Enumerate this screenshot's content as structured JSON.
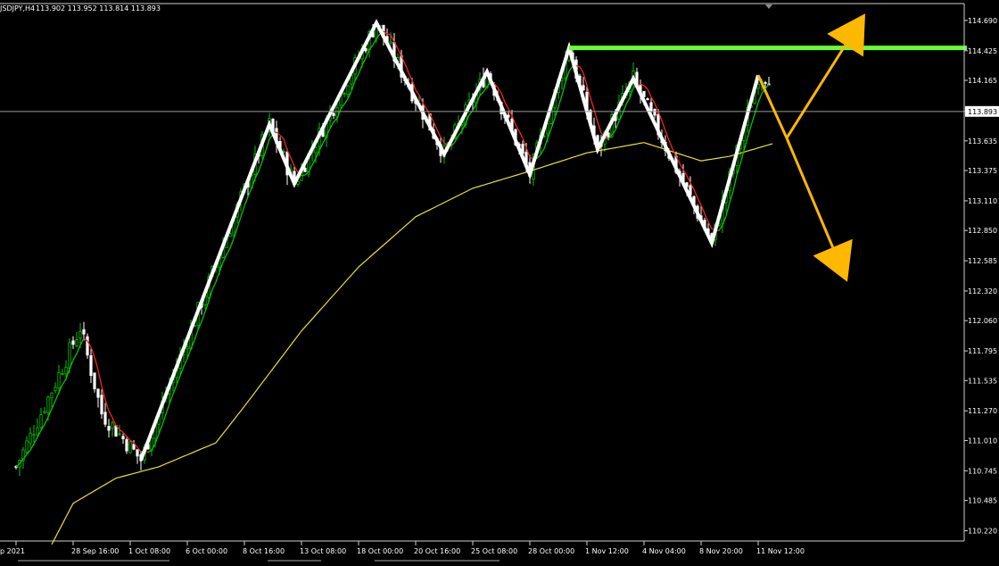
{
  "header": {
    "symbol_tf": "JSDJPY,H4",
    "ohlc": "113.902 113.952 113.814 113.893"
  },
  "colors": {
    "background": "#000000",
    "frame": "#cfcfcf",
    "bull_candle": "#00c800",
    "bear_candle": "#ffffff",
    "ma_slow": "#e8e030",
    "ma_fast_up": "#00c800",
    "ma_fast_down": "#ff2020",
    "zigzag": "#ffffff",
    "resistance": "#66ff33",
    "forecast_arrows": "#ffb800",
    "price_line": "#9a9a9a"
  },
  "chart_data": {
    "type": "candlestick",
    "symbol": "USDJPY",
    "timeframe": "H4",
    "y_ticks": [
      "114.690",
      "114.425",
      "114.165",
      "113.893",
      "113.635",
      "113.375",
      "113.110",
      "112.850",
      "112.585",
      "112.320",
      "112.060",
      "111.795",
      "111.535",
      "111.270",
      "111.010",
      "110.745",
      "110.485",
      "110.220"
    ],
    "y_tick_values": [
      114.69,
      114.425,
      114.165,
      113.893,
      113.635,
      113.375,
      113.11,
      112.85,
      112.585,
      112.32,
      112.06,
      111.795,
      111.535,
      111.27,
      111.01,
      110.745,
      110.485,
      110.22
    ],
    "ylim": [
      110.13,
      114.83
    ],
    "current_price": 113.893,
    "current_price_label": "113.893",
    "x_ticks": [
      "p 2021",
      "28 Sep 16:00",
      "1 Oct 08:00",
      "6 Oct 00:00",
      "8 Oct 16:00",
      "13 Oct 08:00",
      "18 Oct 00:00",
      "20 Oct 16:00",
      "25 Oct 08:00",
      "28 Oct 00:00",
      "1 Nov 12:00",
      "4 Nov 04:00",
      "8 Nov 20:00",
      "11 Nov 12:00"
    ],
    "x_tick_index": [
      0,
      16,
      32,
      48,
      64,
      80,
      96,
      112,
      128,
      144,
      160,
      176,
      192,
      208
    ],
    "bar_count": 216,
    "zigzag": [
      {
        "i": 35,
        "p": 110.84
      },
      {
        "i": 71,
        "p": 113.78
      },
      {
        "i": 78,
        "p": 113.26
      },
      {
        "i": 101,
        "p": 114.67
      },
      {
        "i": 120,
        "p": 113.52
      },
      {
        "i": 132,
        "p": 114.24
      },
      {
        "i": 144,
        "p": 113.34
      },
      {
        "i": 155,
        "p": 114.45
      },
      {
        "i": 163,
        "p": 113.56
      },
      {
        "i": 173,
        "p": 114.18
      },
      {
        "i": 195,
        "p": 112.74
      },
      {
        "i": 208,
        "p": 114.21
      }
    ],
    "slow_ma": [
      {
        "i": 10,
        "p": 110.1
      },
      {
        "i": 16,
        "p": 110.46
      },
      {
        "i": 28,
        "p": 110.68
      },
      {
        "i": 40,
        "p": 110.78
      },
      {
        "i": 56,
        "p": 110.99
      },
      {
        "i": 64,
        "p": 111.31
      },
      {
        "i": 80,
        "p": 111.97
      },
      {
        "i": 96,
        "p": 112.53
      },
      {
        "i": 112,
        "p": 112.97
      },
      {
        "i": 128,
        "p": 113.22
      },
      {
        "i": 144,
        "p": 113.37
      },
      {
        "i": 160,
        "p": 113.53
      },
      {
        "i": 176,
        "p": 113.62
      },
      {
        "i": 192,
        "p": 113.46
      },
      {
        "i": 200,
        "p": 113.5
      },
      {
        "i": 212,
        "p": 113.61
      }
    ],
    "resistance_level": 114.45,
    "resistance_start_index": 155,
    "forecast": {
      "origin": {
        "i": 216,
        "p": 113.66
      },
      "up_target": {
        "i": 238,
        "p": 114.75
      },
      "down_target": {
        "i": 233,
        "p": 112.4
      }
    }
  }
}
